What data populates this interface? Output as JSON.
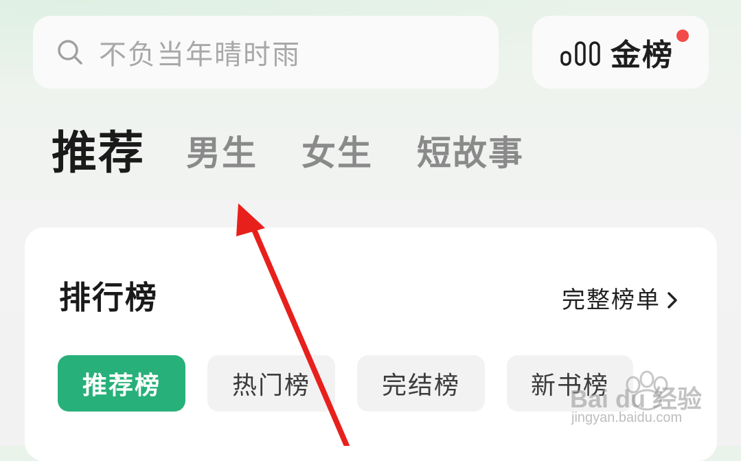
{
  "search": {
    "placeholder": "不负当年晴时雨",
    "icon": "search-icon"
  },
  "rank_button": {
    "label": "金榜",
    "icon": "bar-chart-icon",
    "has_notification": true,
    "notification_color": "#f24a4a"
  },
  "tabs": [
    {
      "label": "推荐",
      "active": true
    },
    {
      "label": "男生",
      "active": false
    },
    {
      "label": "女生",
      "active": false
    },
    {
      "label": "短故事",
      "active": false
    }
  ],
  "ranking_card": {
    "title": "排行榜",
    "more_label": "完整榜单",
    "chips": [
      {
        "label": "推荐榜",
        "active": true
      },
      {
        "label": "热门榜",
        "active": false
      },
      {
        "label": "完结榜",
        "active": false
      },
      {
        "label": "新书榜",
        "active": false
      }
    ]
  },
  "colors": {
    "accent": "#28b07a",
    "annotation_arrow": "#e8201c"
  },
  "watermark": {
    "text": "Bai du 经验",
    "url": "jingyan.baidu.com"
  }
}
